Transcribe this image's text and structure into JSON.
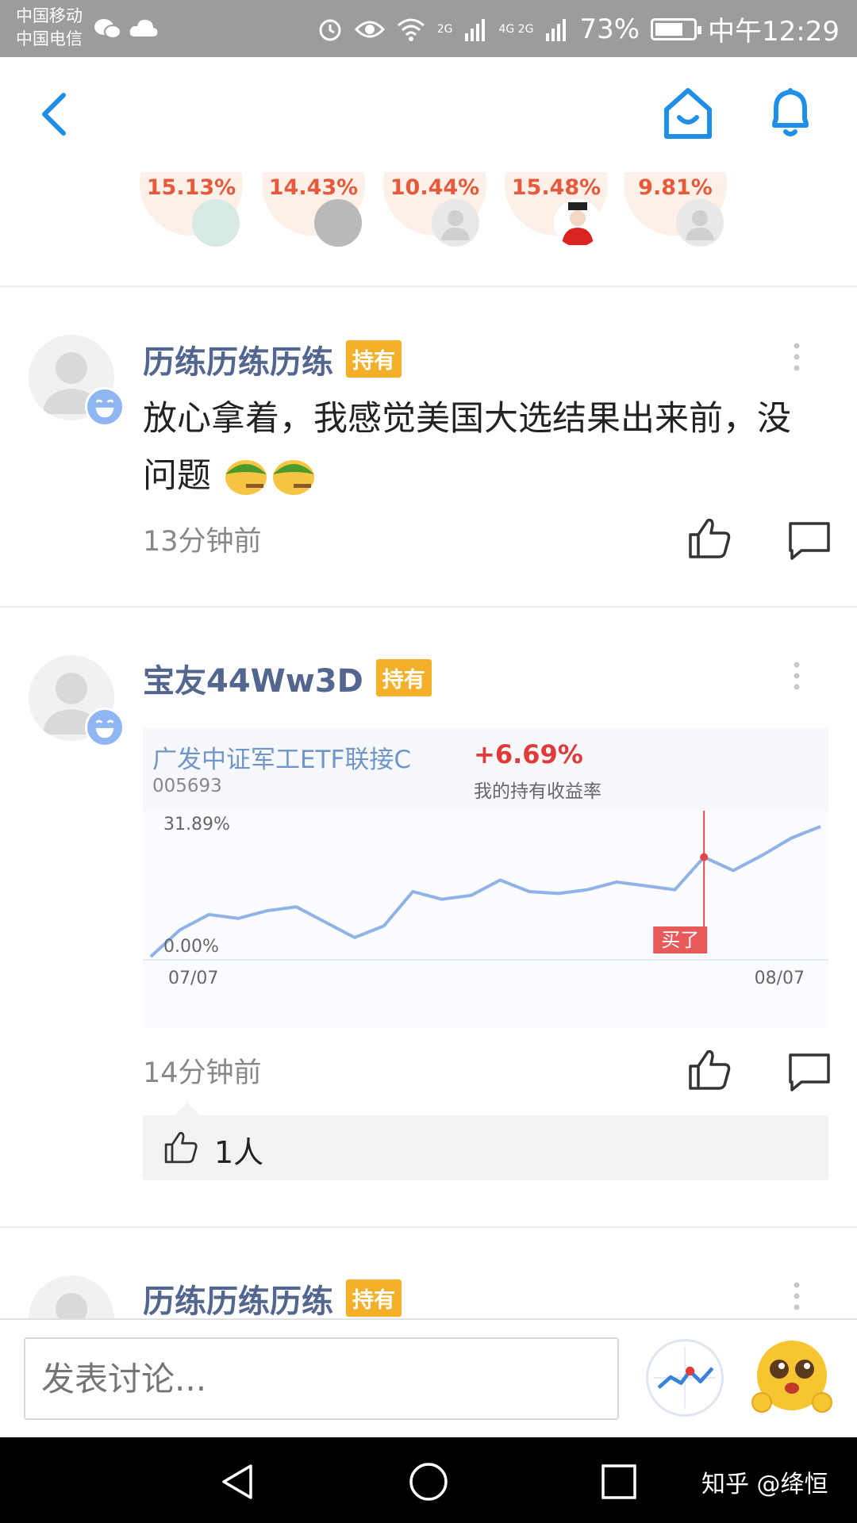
{
  "status_bar": {
    "carrier_1": "中国移动",
    "carrier_2": "中国电信",
    "network_1": "2G",
    "network_2": "4G 2G",
    "battery": "73%",
    "time": "中午12:29",
    "battery_level": 0.73
  },
  "rank_strip": {
    "items": [
      {
        "pct": "15.13%"
      },
      {
        "pct": "14.43%"
      },
      {
        "pct": "10.44%"
      },
      {
        "pct": "15.48%"
      },
      {
        "pct": "9.81%"
      }
    ]
  },
  "posts": [
    {
      "username": "历练历练历练",
      "badge": "持有",
      "text": "放心拿着，我感觉美国大选结果出来前，没问题",
      "time": "13分钟前"
    },
    {
      "username": "宝友44Ww3D",
      "badge": "持有",
      "time": "14分钟前",
      "fund": {
        "name": "广发中证军工ETF联接C",
        "code": "005693",
        "return": "+6.69%",
        "return_label": "我的持有收益率",
        "buy_label": "买了"
      },
      "likes": "1人"
    },
    {
      "username": "历练历练历练",
      "badge": "持有"
    }
  ],
  "chart_data": {
    "type": "line",
    "x_start": "07/07",
    "x_end": "08/07",
    "y_top_label": "31.89%",
    "y_bottom_label": "0.00%",
    "ylim": [
      0,
      31.89
    ],
    "values": [
      0,
      7,
      11,
      10,
      12,
      13,
      9,
      5,
      8,
      17,
      15,
      16,
      20,
      17,
      16.5,
      17.5,
      19.5,
      18.5,
      17.5,
      26,
      22.5,
      26.5,
      31,
      34
    ],
    "buy_index": 19,
    "colors": {
      "line": "#8fb3e6",
      "buy": "#e04848"
    }
  },
  "composer": {
    "placeholder": "发表讨论..."
  },
  "watermark": "知乎 @绛恒"
}
